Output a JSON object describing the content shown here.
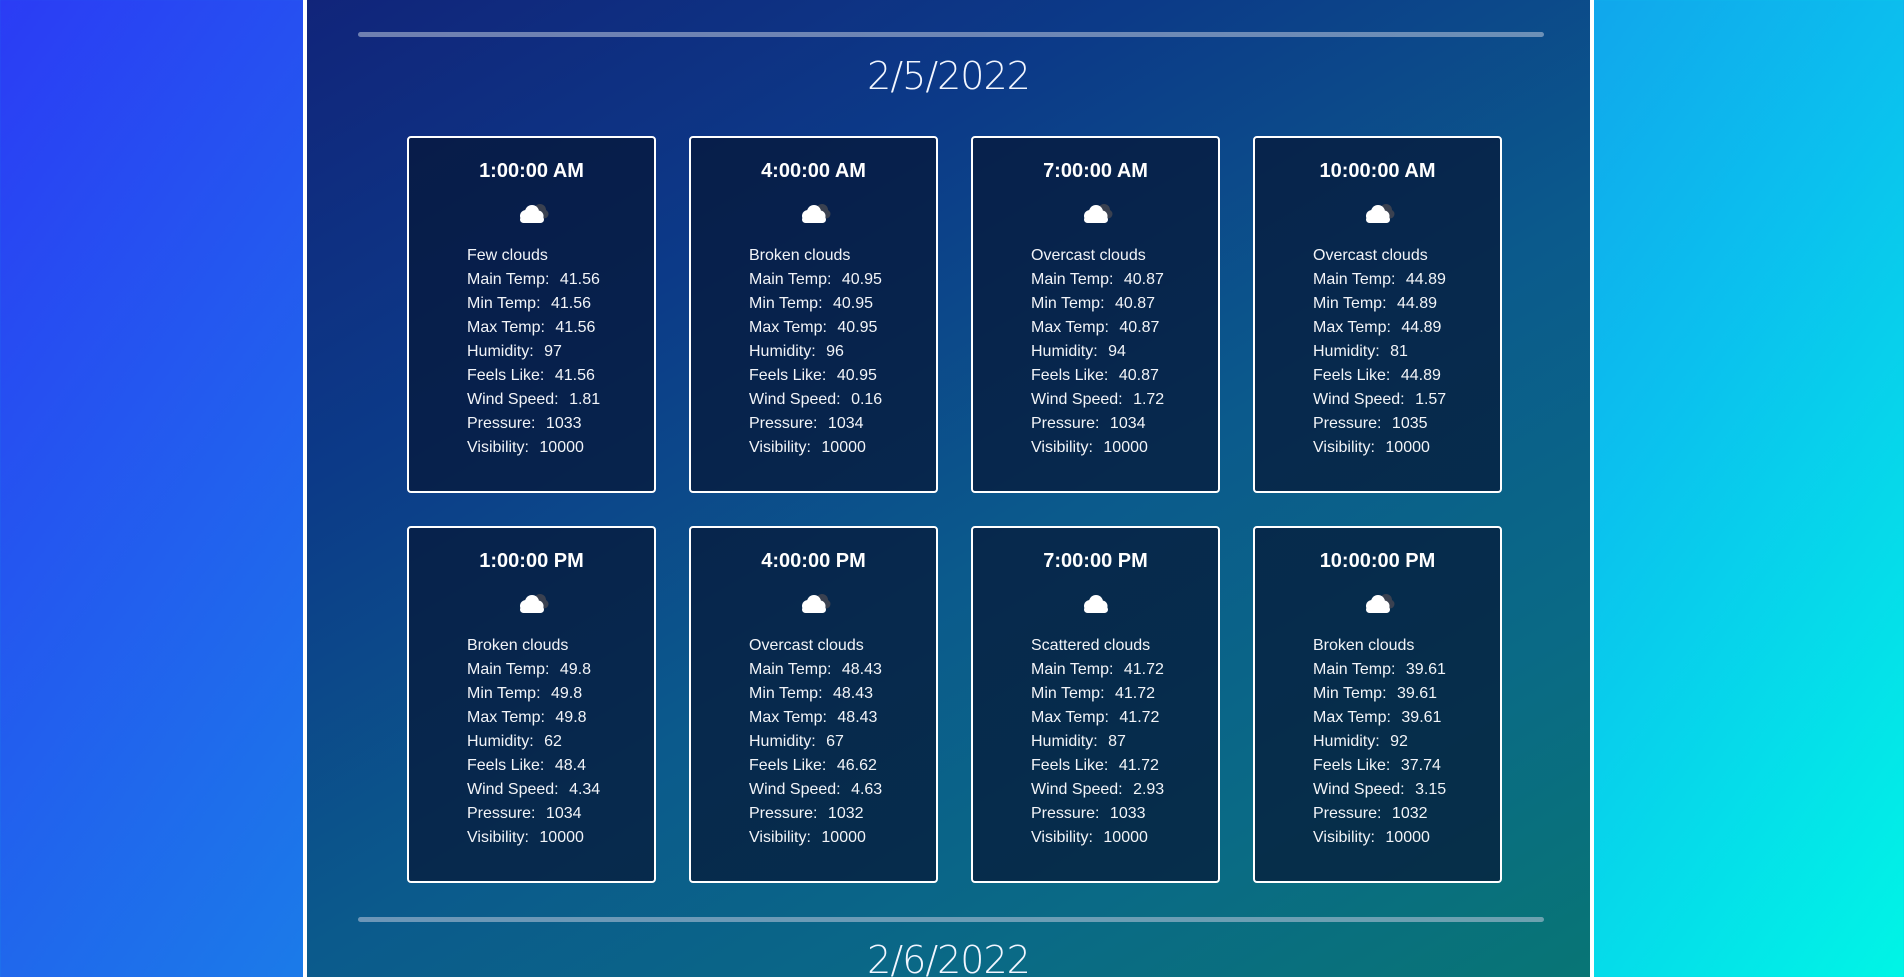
{
  "sections": [
    {
      "date": "2/5/2022",
      "cards": [
        {
          "time": "1:00:00 AM",
          "icon": "few-clouds-icon",
          "description": "Few clouds",
          "main_temp": "41.56",
          "min_temp": "41.56",
          "max_temp": "41.56",
          "humidity": "97",
          "feels_like": "41.56",
          "wind_speed": "1.81",
          "pressure": "1033",
          "visibility": "10000"
        },
        {
          "time": "4:00:00 AM",
          "icon": "broken-clouds-icon",
          "description": "Broken clouds",
          "main_temp": "40.95",
          "min_temp": "40.95",
          "max_temp": "40.95",
          "humidity": "96",
          "feels_like": "40.95",
          "wind_speed": "0.16",
          "pressure": "1034",
          "visibility": "10000"
        },
        {
          "time": "7:00:00 AM",
          "icon": "overcast-clouds-icon",
          "description": "Overcast clouds",
          "main_temp": "40.87",
          "min_temp": "40.87",
          "max_temp": "40.87",
          "humidity": "94",
          "feels_like": "40.87",
          "wind_speed": "1.72",
          "pressure": "1034",
          "visibility": "10000"
        },
        {
          "time": "10:00:00 AM",
          "icon": "overcast-clouds-icon",
          "description": "Overcast clouds",
          "main_temp": "44.89",
          "min_temp": "44.89",
          "max_temp": "44.89",
          "humidity": "81",
          "feels_like": "44.89",
          "wind_speed": "1.57",
          "pressure": "1035",
          "visibility": "10000"
        },
        {
          "time": "1:00:00 PM",
          "icon": "broken-clouds-icon",
          "description": "Broken clouds",
          "main_temp": "49.8",
          "min_temp": "49.8",
          "max_temp": "49.8",
          "humidity": "62",
          "feels_like": "48.4",
          "wind_speed": "4.34",
          "pressure": "1034",
          "visibility": "10000"
        },
        {
          "time": "4:00:00 PM",
          "icon": "overcast-clouds-icon",
          "description": "Overcast clouds",
          "main_temp": "48.43",
          "min_temp": "48.43",
          "max_temp": "48.43",
          "humidity": "67",
          "feels_like": "46.62",
          "wind_speed": "4.63",
          "pressure": "1032",
          "visibility": "10000"
        },
        {
          "time": "7:00:00 PM",
          "icon": "scattered-clouds-icon",
          "description": "Scattered clouds",
          "main_temp": "41.72",
          "min_temp": "41.72",
          "max_temp": "41.72",
          "humidity": "87",
          "feels_like": "41.72",
          "wind_speed": "2.93",
          "pressure": "1033",
          "visibility": "10000"
        },
        {
          "time": "10:00:00 PM",
          "icon": "broken-clouds-icon",
          "description": "Broken clouds",
          "main_temp": "39.61",
          "min_temp": "39.61",
          "max_temp": "39.61",
          "humidity": "92",
          "feels_like": "37.74",
          "wind_speed": "3.15",
          "pressure": "1032",
          "visibility": "10000"
        }
      ]
    },
    {
      "date": "2/6/2022",
      "cards": []
    }
  ],
  "labels": {
    "main_temp": "Main Temp:",
    "min_temp": "Min Temp:",
    "max_temp": "Max Temp:",
    "humidity": "Humidity:",
    "feels_like": "Feels Like:",
    "wind_speed": "Wind Speed:",
    "pressure": "Pressure:",
    "visibility": "Visibility:"
  }
}
